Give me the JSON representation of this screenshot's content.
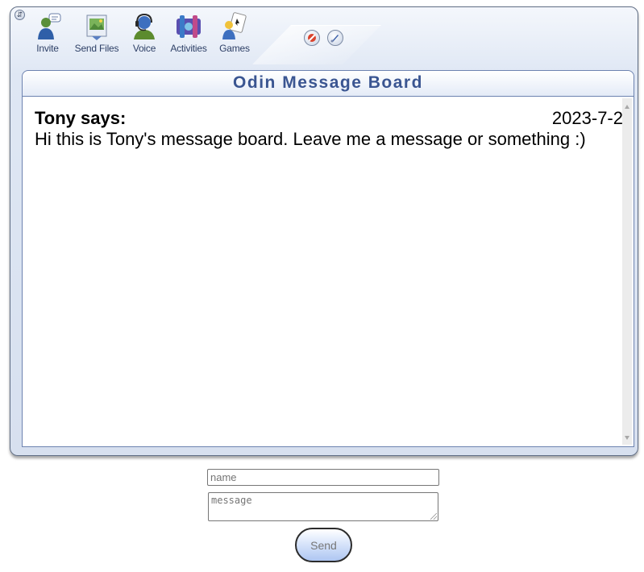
{
  "toolbar": {
    "items": [
      {
        "label": "Invite",
        "icon": "invite-icon"
      },
      {
        "label": "Send Files",
        "icon": "send-files-icon"
      },
      {
        "label": "Voice",
        "icon": "voice-icon"
      },
      {
        "label": "Activities",
        "icon": "activities-icon"
      },
      {
        "label": "Games",
        "icon": "games-icon"
      }
    ],
    "extra_icons": [
      "block-icon",
      "paint-icon"
    ]
  },
  "board": {
    "title": "Odin Message Board",
    "messages": [
      {
        "user_line": "Tony says:",
        "date": "2023-7-2",
        "text": "Hi this is Tony's message board. Leave me a message or something :)"
      }
    ]
  },
  "form": {
    "name_placeholder": "name",
    "message_placeholder": "message",
    "send_label": "Send"
  },
  "colors": {
    "title": "#3a5591",
    "window_bg": "#d7e0ef",
    "panel_border": "#6d83b0"
  }
}
